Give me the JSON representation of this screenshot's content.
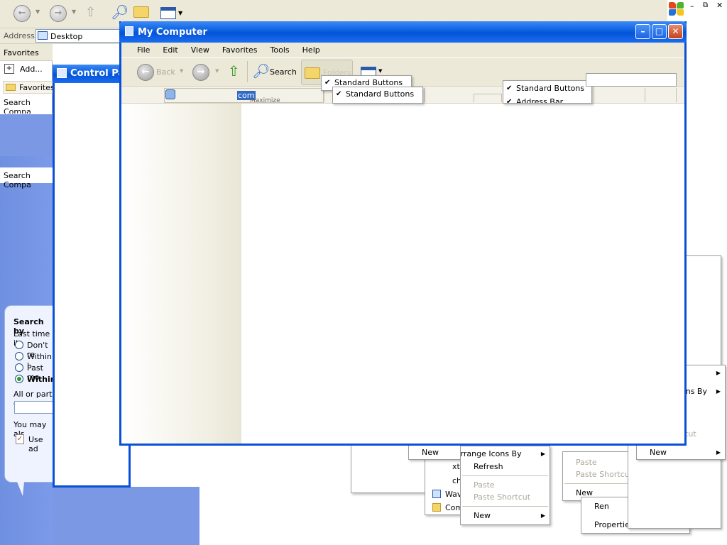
{
  "background_explorer": {
    "address_label": "Address",
    "address_value": "Desktop",
    "favorites_header": "Favorites",
    "add_label": "Add...",
    "favorites_folder": "Favorites",
    "search_companion_1": "Search Compa",
    "search_companion_2": "Search Compa",
    "search_panel": {
      "title": "Search by",
      "subtitle": "Last time it",
      "options": [
        "Don't re",
        "Within l",
        "Past mo",
        "Within"
      ],
      "part_label": "All or part o",
      "also_text": "You may als",
      "checkbox_label": "Use ad"
    }
  },
  "control_panel": {
    "title": "Control Par"
  },
  "my_computer": {
    "title": "My Computer",
    "menu": [
      "File",
      "Edit",
      "View",
      "Favorites",
      "Tools",
      "Help"
    ],
    "toolbar": {
      "back": "Back",
      "search": "Search",
      "folders": "Folders"
    },
    "address_selected": "com",
    "address_overlap": "Maximize"
  },
  "toolbar_menus": {
    "menu_a": [
      "Standard Buttons"
    ],
    "menu_b": [
      "Standard Buttons"
    ],
    "menu_c": [
      "Standard Buttons",
      "Address Bar"
    ]
  },
  "context_menus": {
    "menu_new_left": {
      "new": "New"
    },
    "menu_center": {
      "arrange": "Arrange Icons By",
      "refresh": "Refresh",
      "paste": "Paste",
      "paste_shortcut": "Paste Shortcut",
      "new": "New"
    },
    "menu_mid": {
      "paste": "Paste",
      "paste_shortcut": "Paste Shortcut",
      "new": "New"
    },
    "menu_right": {
      "arrange": "ons By",
      "shortcut": "tcut",
      "new": "New"
    },
    "menu_bottom": {
      "rename": "Ren",
      "properties": "Properties"
    },
    "partial_items": [
      "xt",
      "ch",
      "Wav",
      "Com"
    ]
  }
}
